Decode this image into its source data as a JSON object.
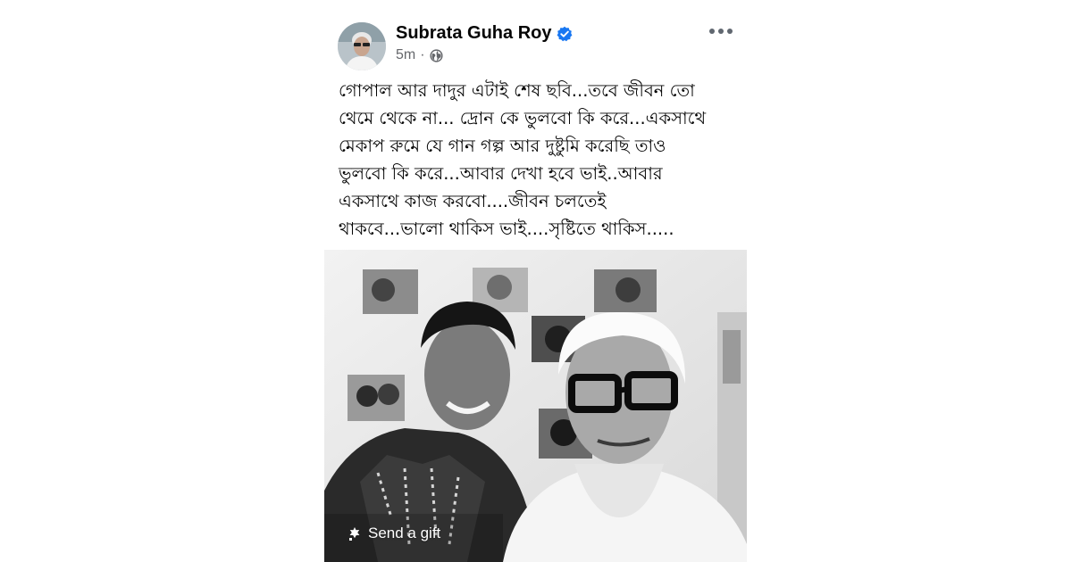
{
  "post": {
    "author": "Subrata Guha Roy",
    "timestamp": "5m",
    "separator": "·",
    "audience_icon": "globe-icon",
    "verified_icon": "verified-badge-icon",
    "more_icon": "more-options-icon",
    "text_lines": [
      "গোপাল আর দাদুর এটাই শেষ ছবি...তবে জীবন তো",
      "থেমে থেকে না... দ্রোন কে ভুলবো কি করে...একসাথে",
      "মেকাপ রুমে যে গান গল্প আর দুষ্টুমি করেছি তাও",
      "ভুলবো কি করে...আবার দেখা হবে ভাই..আবার",
      "একসাথে কাজ করবো....জীবন চলতেই",
      "থাকবে...ভালো থাকিস ভাই....সৃষ্টিতে থাকিস....."
    ]
  },
  "photo": {
    "gift_label": "Send a gift",
    "gift_icon": "gift-icon"
  },
  "colors": {
    "verified": "#1877f2",
    "meta_text": "#65676b",
    "body_text": "#050505"
  }
}
